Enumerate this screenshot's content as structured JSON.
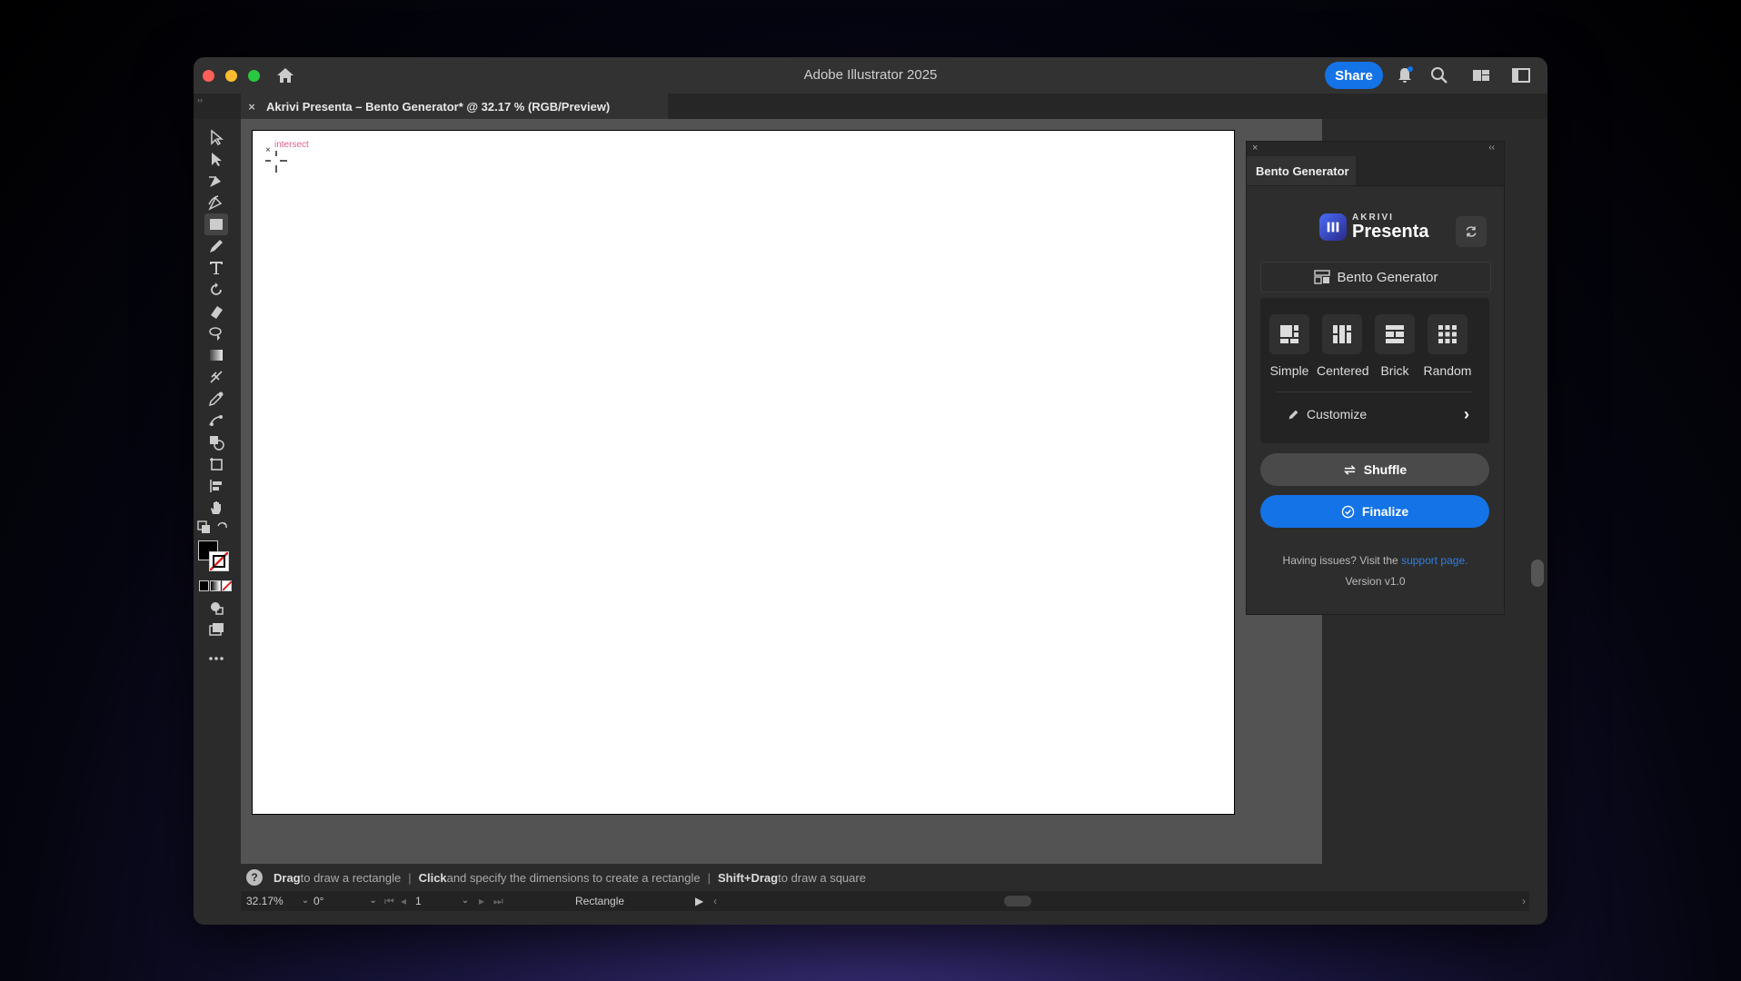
{
  "window": {
    "title": "Adobe Illustrator 2025"
  },
  "header": {
    "share_label": "Share"
  },
  "document_tab": {
    "title": "Akrivi Presenta – Bento Generator* @ 32.17 % (RGB/Preview)",
    "close": "×"
  },
  "canvas": {
    "hint": "intersect",
    "cursor_mark": "×"
  },
  "status": {
    "help": "?",
    "parts": [
      {
        "bold": "Drag",
        "text": " to draw a rectangle"
      },
      {
        "bold": "Click",
        "text": " and specify the dimensions to create a rectangle"
      },
      {
        "bold": "Shift+Drag",
        "text": " to draw a square"
      }
    ],
    "separator": "|"
  },
  "bottom": {
    "zoom": "32.17%",
    "rotation": "0°",
    "artboard": "1",
    "tool": "Rectangle"
  },
  "panel": {
    "tab": "Bento Generator",
    "brand_small": "AKRIVI",
    "brand_big": "Presenta",
    "section": "Bento Generator",
    "layouts": [
      {
        "label": "Simple",
        "icon": "simple-layout-icon"
      },
      {
        "label": "Centered",
        "icon": "centered-layout-icon"
      },
      {
        "label": "Brick",
        "icon": "brick-layout-icon"
      },
      {
        "label": "Random",
        "icon": "random-layout-icon"
      }
    ],
    "customize": "Customize",
    "shuffle": "Shuffle",
    "finalize": "Finalize",
    "help_prefix": "Having issues? Visit the ",
    "help_link": "support page.",
    "version": "Version v1.0",
    "colors": {
      "accent": "#1473e6"
    }
  }
}
